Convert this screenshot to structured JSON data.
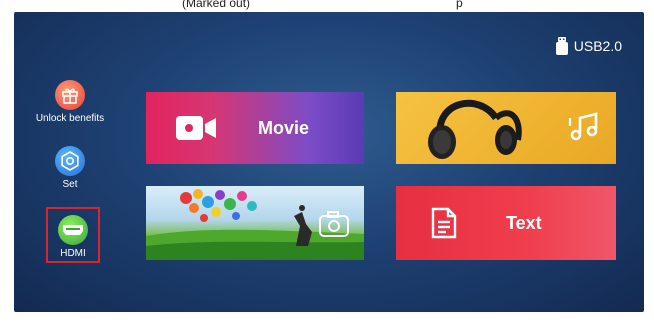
{
  "top_caption": {
    "left": "(Marked out)",
    "right": "p"
  },
  "status": {
    "usb_label": "USB2.0",
    "usb_icon": "usb-drive-icon"
  },
  "sidebar": {
    "items": [
      {
        "label": "Unlock benefits",
        "icon": "gift-icon"
      },
      {
        "label": "Set",
        "icon": "settings-icon"
      },
      {
        "label": "HDMI",
        "icon": "hdmi-icon",
        "selected": true
      }
    ]
  },
  "tiles": {
    "movie": {
      "label": "Movie",
      "icon": "video-camera-icon"
    },
    "music": {
      "icon": "music-note-icon"
    },
    "photo": {
      "icon": "camera-icon"
    },
    "text": {
      "label": "Text",
      "icon": "document-icon"
    }
  },
  "colors": {
    "background": "#1e4173",
    "highlight_border": "#d8262c",
    "movie": "#e2245f",
    "music": "#f6c242",
    "text": "#e62f40"
  }
}
